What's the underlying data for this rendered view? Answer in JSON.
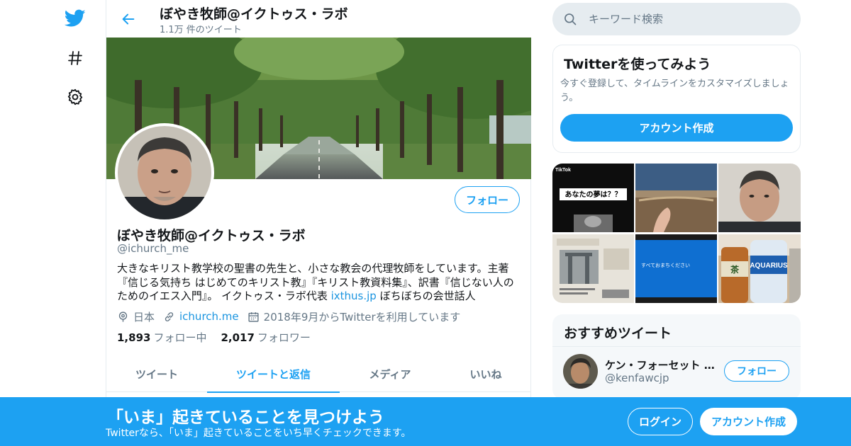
{
  "colors": {
    "accent": "#1da1f2",
    "link": "#1b95e0",
    "text_primary": "#14171a",
    "text_secondary": "#657786",
    "border": "#e6ecf0"
  },
  "nav": {
    "icons": [
      "twitter-logo-icon",
      "hashtag-icon",
      "gear-icon"
    ]
  },
  "header": {
    "title": "ぼやき牧師@イクトゥス・ラボ",
    "tweet_count": "1.1万 件のツイート"
  },
  "profile": {
    "follow_label": "フォロー",
    "name": "ぼやき牧師@イクトゥス・ラボ",
    "handle": "@ichurch_me",
    "bio_text": "大きなキリスト教学校の聖書の先生と、小さな教会の代理牧師をしています。主著『信じる気持ち はじめてのキリスト教』『キリスト教資料集』、訳書『信じない人のためのイエス入門』。 イクトゥス・ラボ代表 ",
    "bio_link": "ixthus.jp",
    "bio_tail": "  ぼちぼちの会世話人",
    "location": "日本",
    "url": "ichurch.me",
    "joined": "2018年9月からTwitterを利用しています",
    "following_count": "1,893",
    "following_label": "フォロー中",
    "followers_count": "2,017",
    "followers_label": "フォロワー"
  },
  "tabs": [
    {
      "label": "ツイート",
      "active": false
    },
    {
      "label": "ツイートと返信",
      "active": true
    },
    {
      "label": "メディア",
      "active": false
    },
    {
      "label": "いいね",
      "active": false
    }
  ],
  "search": {
    "placeholder": "キーワード検索"
  },
  "signup_card": {
    "title": "Twitterを使ってみよう",
    "description": "今すぐ登録して、タイムラインをカスタマイズしましょう。",
    "button": "アカウント作成"
  },
  "media": {
    "tiktok_label": "TikTok",
    "tiktok_caption": "あなたの夢は？？",
    "blue_screen_text": "すべておまちください",
    "bottle_label": "AQUARIUS",
    "tea_label": "茶"
  },
  "recommended": {
    "title": "おすすめツイート",
    "name": "ケン・フォーセット Ken Fawcett",
    "handle": "@kenfawcjp",
    "follow_label": "フォロー"
  },
  "bottom_bar": {
    "title": "「いま」起きていることを見つけよう",
    "subtitle": "Twitterなら、「いま」起きていることをいち早くチェックできます。",
    "login": "ログイン",
    "signup": "アカウント作成"
  }
}
